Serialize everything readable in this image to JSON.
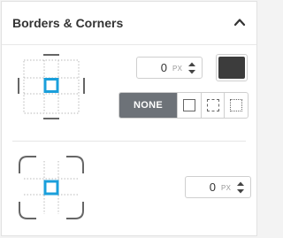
{
  "panel": {
    "title": "Borders & Corners",
    "collapse_icon": "chevron-up-icon"
  },
  "border": {
    "width_value": "0",
    "width_unit": "PX",
    "color": "#3c3c3c",
    "styles": [
      {
        "label": "NONE",
        "selected": true
      },
      {
        "icon": "solid-border-icon"
      },
      {
        "icon": "dashed-border-icon"
      },
      {
        "icon": "dotted-border-icon"
      }
    ]
  },
  "corners": {
    "radius_value": "0",
    "radius_unit": "PX"
  },
  "colors": {
    "accent": "#1a9fdb",
    "selected_segment": "#6d7278"
  }
}
